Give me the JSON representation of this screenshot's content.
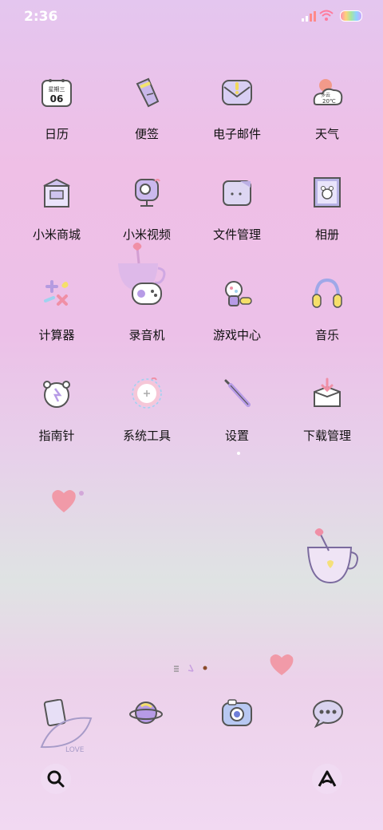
{
  "status": {
    "time": "2:36"
  },
  "apps": [
    {
      "label": "日历",
      "icon": "calendar-icon",
      "sub1": "星期三",
      "sub2": "06"
    },
    {
      "label": "便签",
      "icon": "pencil-note-icon"
    },
    {
      "label": "电子邮件",
      "icon": "mail-icon"
    },
    {
      "label": "天气",
      "icon": "weather-icon",
      "sub1": "多云",
      "sub2": "20℃"
    },
    {
      "label": "小米商城",
      "icon": "store-icon"
    },
    {
      "label": "小米视频",
      "icon": "video-camera-icon"
    },
    {
      "label": "文件管理",
      "icon": "folder-icon"
    },
    {
      "label": "相册",
      "icon": "gallery-icon"
    },
    {
      "label": "计算器",
      "icon": "calculator-icon"
    },
    {
      "label": "录音机",
      "icon": "recorder-icon"
    },
    {
      "label": "游戏中心",
      "icon": "game-center-icon"
    },
    {
      "label": "音乐",
      "icon": "headphones-icon"
    },
    {
      "label": "指南针",
      "icon": "compass-icon"
    },
    {
      "label": "系统工具",
      "icon": "system-tools-icon"
    },
    {
      "label": "设置",
      "icon": "settings-icon"
    },
    {
      "label": "下载管理",
      "icon": "download-icon"
    }
  ],
  "dock": [
    {
      "icon": "phone-icon",
      "deco_text": "LOVE"
    },
    {
      "icon": "browser-planet-icon"
    },
    {
      "icon": "camera-icon"
    },
    {
      "icon": "messages-icon"
    }
  ],
  "bottom": {
    "left_icon": "search-icon",
    "right_icon": "app-drawer-icon"
  }
}
